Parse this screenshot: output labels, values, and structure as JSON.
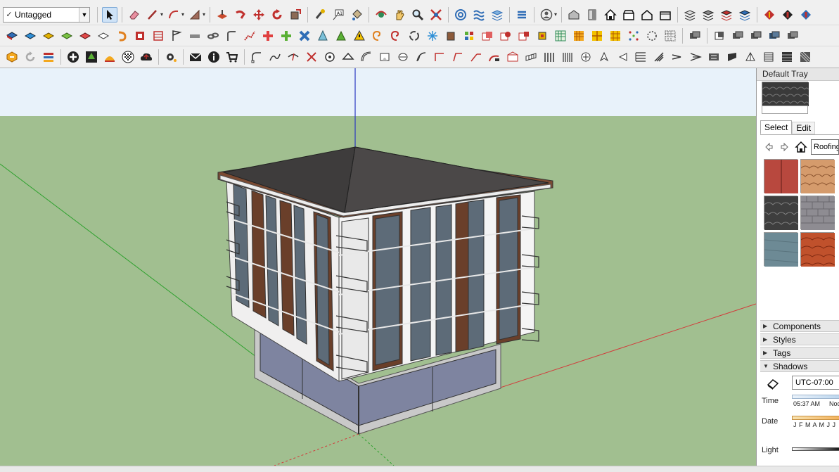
{
  "toolbar": {
    "tag_selector": {
      "value": "Untagged",
      "check": "✓"
    },
    "row1_icons": [
      "select-icon",
      "eraser-icon",
      "line-icon",
      "arc-icon",
      "shape-icon",
      "push-pull-icon",
      "follow-me-icon",
      "move-icon",
      "rotate-icon",
      "scale-icon",
      "tape-measure-icon",
      "text-icon",
      "paint-bucket-icon",
      "orbit-icon",
      "pan-icon",
      "zoom-icon",
      "zoom-extents-icon",
      "sandbox-icon",
      "wave-icon",
      "layers-icon",
      "stack-icon",
      "account-icon",
      "warehouse-icon",
      "door-icon",
      "home-icon",
      "store-icon",
      "house-outline-icon",
      "building-icon",
      "materials-a-icon",
      "materials-b-icon",
      "materials-c-icon",
      "globe-icon",
      "extension-a-icon",
      "extension-b-icon",
      "extension-c-icon"
    ],
    "row2_icons": [
      "iso-view-icon",
      "top-view-icon",
      "front-view-icon",
      "right-view-icon",
      "back-view-icon",
      "left-view-icon",
      "undo-icon",
      "redo-icon",
      "section-plane-icon",
      "flag-icon",
      "pipe-icon",
      "chain-icon",
      "curve-icon",
      "node-icon",
      "cross-icon",
      "plus-icon",
      "x-cross-icon",
      "cone-icon",
      "triangle-icon",
      "warning-icon",
      "spiral-icon",
      "vortex-icon",
      "swirl-icon",
      "snowflake-icon",
      "cube-icon",
      "puzzle-icon",
      "brick-icon",
      "mosaic-icon",
      "tile-icon",
      "grid-icon",
      "grid-yellow-icon",
      "orange-grid-icon",
      "yellow-grid-icon",
      "scatter-icon",
      "circle-dots-icon",
      "dotted-grid-icon",
      "stack-a-icon",
      "stack-b-icon",
      "stack-c-icon",
      "stack-d-icon",
      "stack-e-icon",
      "stack-f-icon",
      "stack-g-icon"
    ],
    "row3_icons": [
      "sketchup-logo-icon",
      "sync-icon",
      "layers-stack-icon",
      "add-circle-icon",
      "tree-icon",
      "gradient-icon",
      "checker-icon",
      "cloud-upload-icon",
      "settings-gear-icon",
      "mail-icon",
      "info-icon",
      "cart-icon",
      "curve-a-icon",
      "curve-b-icon",
      "curve-c-icon",
      "curve-d-icon",
      "curve-e-icon",
      "curve-f-icon",
      "curve-g-icon",
      "curve-h-icon",
      "curve-i-icon",
      "corner-a-icon",
      "corner-b-icon",
      "corner-c-icon",
      "corner-d-icon",
      "stair-icon",
      "roof-icon",
      "fence-icon",
      "fence-b-icon",
      "hand-icon",
      "leaf-icon",
      "arrow-left-icon",
      "fan-icon",
      "blade-icon",
      "arrows-icon",
      "arrows-b-icon",
      "film-icon",
      "slab-icon",
      "music-icon",
      "door-panel-icon",
      "column-icon",
      "pattern-icon",
      "pattern-b-icon"
    ]
  },
  "tray": {
    "title": "Default Tray",
    "tabs": {
      "select": "Select",
      "edit": "Edit"
    },
    "library_value": "Roofing",
    "swatches": [
      {
        "name": "red-standing-seam",
        "color": "#b8483e"
      },
      {
        "name": "orange-shingles",
        "color": "#d59b6c"
      },
      {
        "name": "dark-slate-shingles",
        "color": "#3e3e3e"
      },
      {
        "name": "grey-shingles",
        "color": "#8e8c92"
      },
      {
        "name": "blue-grey-tile",
        "color": "#6d8a95"
      },
      {
        "name": "terracotta-tile",
        "color": "#c0512c"
      }
    ],
    "sections": {
      "components": "Components",
      "styles": "Styles",
      "tags": "Tags",
      "shadows": "Shadows"
    },
    "shadows": {
      "timezone": "UTC-07:00",
      "time_label": "Time",
      "time_start": "05:37 AM",
      "time_noon": "Noo",
      "date_label": "Date",
      "months": "J F M A M J J",
      "light_label": "Light"
    }
  },
  "colors": {
    "sky": "#e8f2fa",
    "ground": "#a1bf90",
    "accent": "#cfe3f7"
  }
}
